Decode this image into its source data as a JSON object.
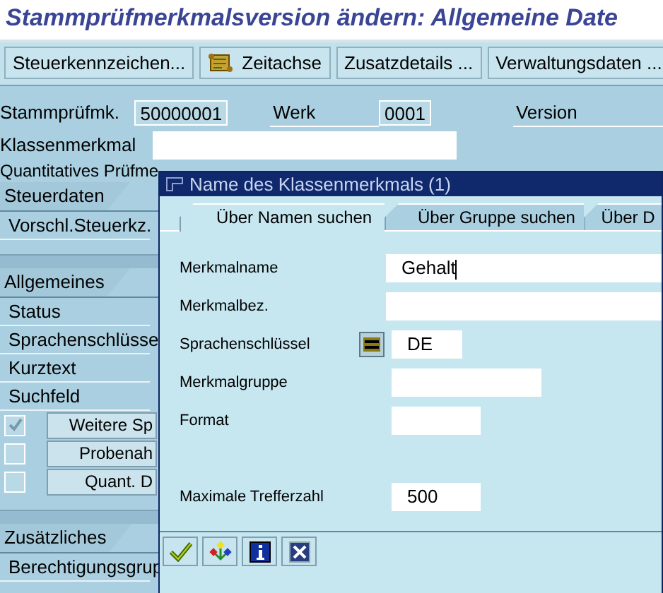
{
  "window": {
    "title": "Stammprüfmerkmalsversion ändern: Allgemeine Date"
  },
  "toolbar": [
    {
      "kind": "text",
      "label": "Steuerkennzeichen..."
    },
    {
      "kind": "scroll",
      "label": "Zeitachse"
    },
    {
      "kind": "text",
      "label": "Zusatzdetails ..."
    },
    {
      "kind": "text",
      "label": "Verwaltungsdaten ..."
    }
  ],
  "header": {
    "master_label": "Stammprüfmk.",
    "master_value": "50000001",
    "plant_label": "Werk",
    "plant_value": "0001",
    "version_label": "Version",
    "class_label": "Klassenmerkmal",
    "summary": "Quantitatives Prüfme"
  },
  "sections": [
    {
      "title": "Steuerdaten",
      "rows": [
        {
          "kind": "label",
          "text": "Vorschl.Steuerkz."
        }
      ]
    },
    {
      "title": "Allgemeines",
      "rows": [
        {
          "kind": "label",
          "text": "Status"
        },
        {
          "kind": "label",
          "text": "Sprachenschlüsse"
        },
        {
          "kind": "label",
          "text": "Kurztext"
        },
        {
          "kind": "label",
          "text": "Suchfeld"
        },
        {
          "kind": "check",
          "checked": true,
          "text": "Weitere Sp"
        },
        {
          "kind": "check",
          "checked": false,
          "text": "Probenah"
        },
        {
          "kind": "check",
          "checked": false,
          "text": "Quant. D"
        }
      ]
    },
    {
      "title": "Zusätzliches",
      "rows": [
        {
          "kind": "label",
          "text": "Berechtigungsgrup"
        }
      ]
    }
  ],
  "dialog": {
    "title": "Name des Klassenmerkmals (1)",
    "tabs": [
      {
        "label": "Über Namen suchen",
        "selected": true
      },
      {
        "label": "Über Gruppe suchen",
        "selected": false
      },
      {
        "label": "Über D",
        "selected": false
      }
    ],
    "fields": [
      {
        "kind": "text",
        "label": "Merkmalname",
        "value": "Gehalt"
      },
      {
        "kind": "text",
        "label": "Merkmalbez."
      },
      {
        "kind": "lookup",
        "label": "Sprachenschlüssel",
        "value": "DE"
      },
      {
        "kind": "text",
        "label": "Merkmalgruppe"
      },
      {
        "kind": "text",
        "label": "Format"
      },
      {
        "kind": "text",
        "label": "Maximale Trefferzahl",
        "value": "500"
      }
    ],
    "buttons": [
      {
        "kind": "confirm"
      },
      {
        "kind": "hierarchy"
      },
      {
        "kind": "info"
      },
      {
        "kind": "cancel"
      }
    ]
  }
}
